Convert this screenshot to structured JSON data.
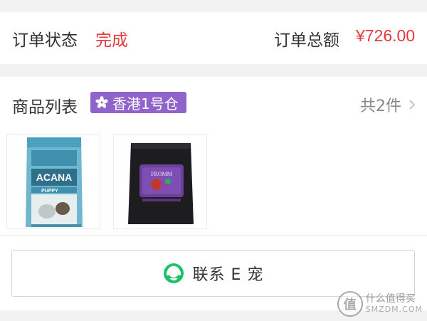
{
  "order_status": {
    "label": "订单状态",
    "value": "完成",
    "total_label": "订单总额",
    "total_value": "¥726.00"
  },
  "product_list": {
    "title": "商品列表",
    "warehouse_badge": "香港1号仓",
    "count_text": "共2件",
    "products": [
      {
        "brand_text": "ACANA",
        "sub_text": "PUPPY",
        "icon": "dog-food-bag-blue"
      },
      {
        "brand_text": "FROMM",
        "icon": "dog-food-bag-black"
      }
    ]
  },
  "contact": {
    "label": "联系 E 宠",
    "icon": "customer-service-icon"
  },
  "watermark": {
    "logo_char": "值",
    "cn": "什么值得买",
    "en": "SMZDM.COM"
  },
  "colors": {
    "red": "#e4393c",
    "badge_purple": "#8f63c9",
    "service_green": "#1dbf6a"
  }
}
